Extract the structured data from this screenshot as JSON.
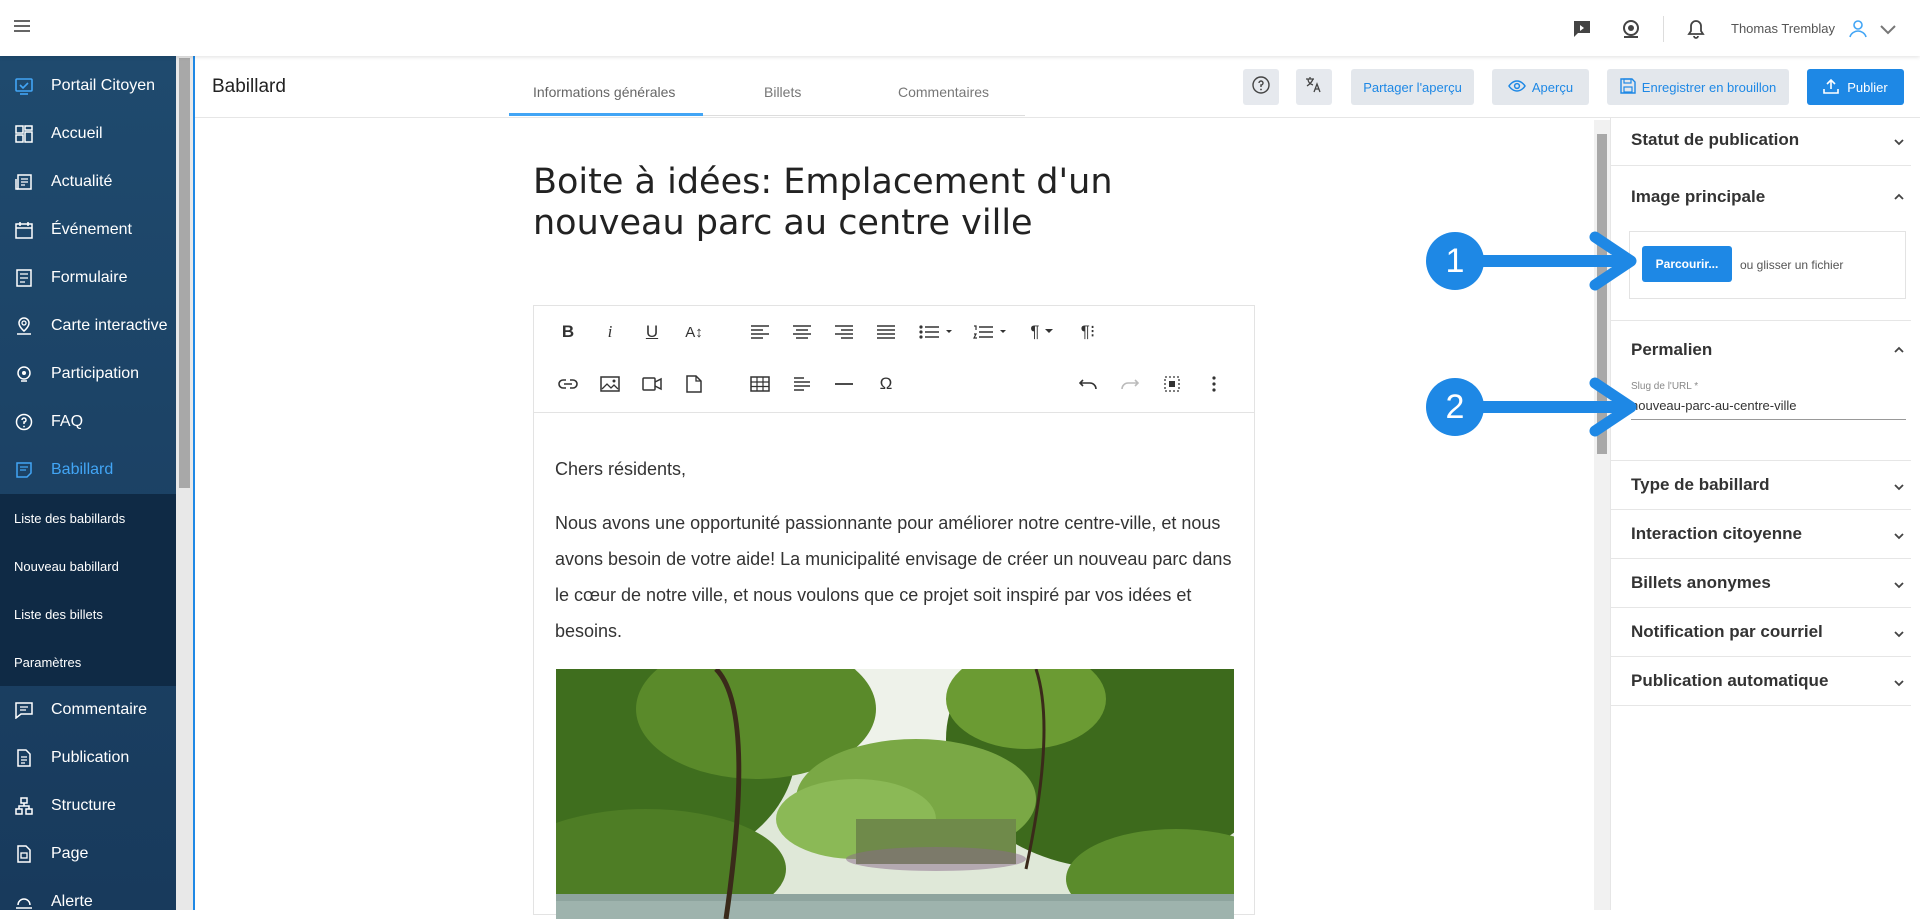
{
  "topbar": {
    "user_name": "Thomas Tremblay"
  },
  "sidebar": {
    "items": [
      {
        "label": "Portail Citoyen",
        "icon": "portal-icon"
      },
      {
        "label": "Accueil",
        "icon": "dashboard-icon"
      },
      {
        "label": "Actualité",
        "icon": "news-icon"
      },
      {
        "label": "Événement",
        "icon": "calendar-icon"
      },
      {
        "label": "Formulaire",
        "icon": "form-icon"
      },
      {
        "label": "Carte interactive",
        "icon": "map-pin-icon"
      },
      {
        "label": "Participation",
        "icon": "participation-icon"
      },
      {
        "label": "FAQ",
        "icon": "question-icon"
      },
      {
        "label": "Babillard",
        "icon": "board-icon"
      },
      {
        "label": "Commentaire",
        "icon": "comment-icon"
      },
      {
        "label": "Publication",
        "icon": "document-icon"
      },
      {
        "label": "Structure",
        "icon": "structure-icon"
      },
      {
        "label": "Page",
        "icon": "page-icon"
      },
      {
        "label": "Alerte",
        "icon": "alert-icon"
      }
    ],
    "sub_items": [
      "Liste des babillards",
      "Nouveau babillard",
      "Liste des billets",
      "Paramètres"
    ]
  },
  "header": {
    "title": "Babillard",
    "tabs": [
      "Informations générales",
      "Billets",
      "Commentaires"
    ],
    "share_preview": "Partager l'aperçu",
    "preview": "Aperçu",
    "save_draft": "Enregistrer en brouillon",
    "publish": "Publier"
  },
  "document": {
    "title": "Boite à idées: Emplacement d'un nouveau parc au centre ville",
    "greeting": "Chers résidents,",
    "paragraph": "Nous avons une opportunité passionnante pour améliorer notre centre-ville, et nous avons besoin de votre aide! La municipalité envisage de créer un nouveau parc dans le cœur de notre ville, et nous voulons que ce projet soit inspiré par vos idées et besoins."
  },
  "panel": {
    "sections": {
      "status": "Statut de publication",
      "image": "Image principale",
      "permalink": "Permalien",
      "type": "Type de babillard",
      "interaction": "Interaction citoyenne",
      "anonymous": "Billets anonymes",
      "notification": "Notification par courriel",
      "auto": "Publication automatique"
    },
    "browse": "Parcourir...",
    "drop_text": "ou glisser un fichier",
    "slug_label": "Slug de l'URL *",
    "slug_value": "nouveau-parc-au-centre-ville"
  },
  "annotations": {
    "one": "1",
    "two": "2"
  },
  "colors": {
    "accent": "#1e88e5",
    "sidebar": "#1f4a6e",
    "annotation": "#1e88e5"
  }
}
